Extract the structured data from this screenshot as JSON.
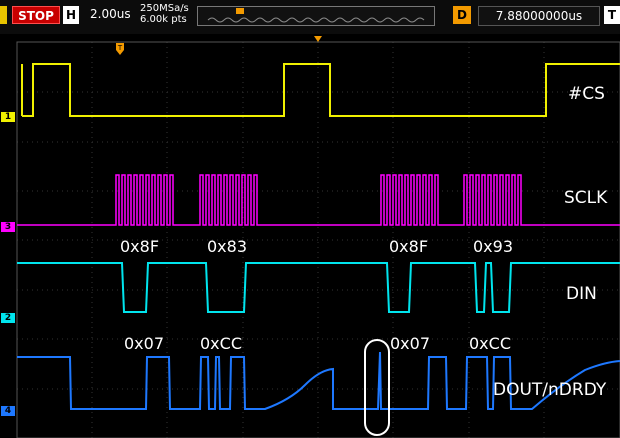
{
  "toolbar": {
    "run_state": "STOP",
    "timebase_mode": "H",
    "timebase": "2.00us",
    "sample_rate": "250MSa/s",
    "memory_depth": "6.00k pts",
    "trigger_marker": "T",
    "delay_mode": "D",
    "delay_value": "7.88000000us",
    "trigger_menu": "T"
  },
  "channels": [
    {
      "id": "1",
      "name": "#CS",
      "color": "#f0f000"
    },
    {
      "id": "3",
      "name": "SCLK",
      "color": "#ff00ff"
    },
    {
      "id": "2",
      "name": "DIN",
      "color": "#00e5ee"
    },
    {
      "id": "4",
      "name": "DOUT/nDRDY",
      "color": "#1e78ff"
    }
  ],
  "decode": {
    "din": [
      "0x8F",
      "0x83",
      "0x8F",
      "0x93"
    ],
    "dout": [
      "0x07",
      "0xCC",
      "0x07",
      "0xCC"
    ]
  },
  "colors": {
    "grid": "#3a3a3a",
    "trigger_orange": "#f39a00",
    "highlight": "#ffffff"
  }
}
